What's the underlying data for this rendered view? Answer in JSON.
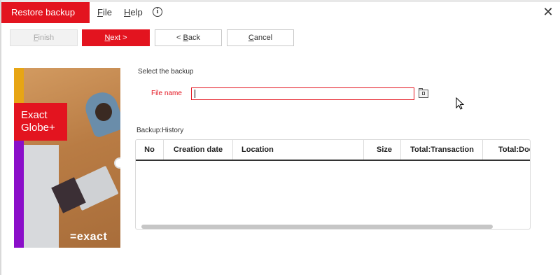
{
  "window": {
    "title": "Restore backup",
    "close_glyph": "✕",
    "info_glyph": "i"
  },
  "menu": {
    "file_accel": "F",
    "file_rest": "ile",
    "help_accel": "H",
    "help_rest": "elp"
  },
  "toolbar": {
    "finish": {
      "accel": "F",
      "rest": "inish"
    },
    "next": {
      "accel": "N",
      "rest": "ext >"
    },
    "back": {
      "pre": "< ",
      "accel": "B",
      "rest": "ack"
    },
    "cancel": {
      "accel": "C",
      "rest": "ancel"
    }
  },
  "sidebar": {
    "brand_line1": "Exact",
    "brand_line2": "Globe+",
    "logo": "=exact"
  },
  "form": {
    "section_title": "Select the backup",
    "file_name_label": "File name",
    "file_name_value": ""
  },
  "history": {
    "title": "Backup:History",
    "columns": [
      "No",
      "Creation date",
      "Location",
      "Size",
      "Total:Transaction",
      "Total:Doc"
    ],
    "rows": []
  },
  "colors": {
    "accent": "#e3141f",
    "yellow": "#e7a514",
    "purple": "#8a0ec9"
  },
  "icons": [
    "info-icon",
    "close-icon",
    "folder-browse-icon",
    "mouse-pointer-icon"
  ]
}
